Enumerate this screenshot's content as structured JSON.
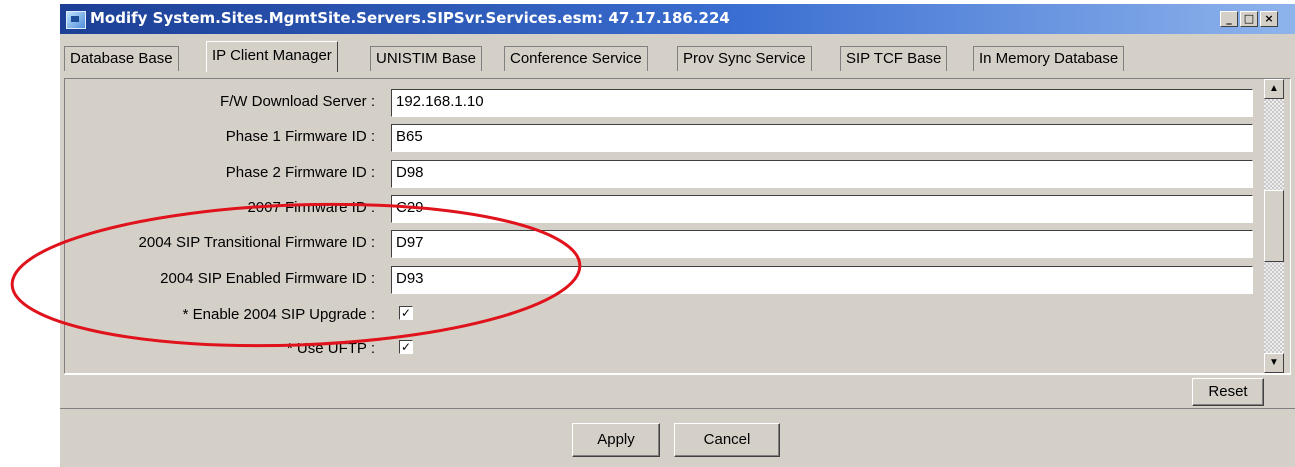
{
  "window": {
    "title": "Modify System.Sites.MgmtSite.Servers.SIPSvr.Services.esm: 47.17.186.224",
    "controls": {
      "minimize": "_",
      "maximize": "□",
      "close": "×"
    }
  },
  "tabs": [
    {
      "label": "Database Base",
      "active": false
    },
    {
      "label": "IP Client Manager",
      "active": true
    },
    {
      "label": "UNISTIM Base",
      "active": false
    },
    {
      "label": "Conference Service",
      "active": false
    },
    {
      "label": "Prov Sync Service",
      "active": false
    },
    {
      "label": "SIP TCF Base",
      "active": false
    },
    {
      "label": "In Memory Database",
      "active": false
    }
  ],
  "fields": [
    {
      "label": "F/W Download Server :",
      "value": "192.168.1.10"
    },
    {
      "label": "Phase 1 Firmware ID :",
      "value": "B65"
    },
    {
      "label": "Phase 2 Firmware ID :",
      "value": "D98"
    },
    {
      "label": "2007 Firmware ID :",
      "value": "C29"
    },
    {
      "label": "2004 SIP Transitional Firmware ID :",
      "value": "D97"
    },
    {
      "label": "2004 SIP Enabled Firmware ID :",
      "value": "D93"
    }
  ],
  "checkboxes": [
    {
      "label": "* Enable 2004 SIP Upgrade :",
      "checked": true,
      "mark": "✓"
    },
    {
      "label": "* Use UFTP :",
      "checked": true,
      "mark": "✓"
    }
  ],
  "scrollbar": {
    "up": "▲",
    "down": "▼"
  },
  "buttons": {
    "reset": "Reset",
    "apply": "Apply",
    "cancel": "Cancel"
  },
  "annotation": {
    "shape": "ellipse",
    "color": "#e0121b"
  },
  "colors": {
    "titlebar_start": "#1c3f95",
    "titlebar_end": "#8fb4ec",
    "face": "#d4d0c8"
  }
}
